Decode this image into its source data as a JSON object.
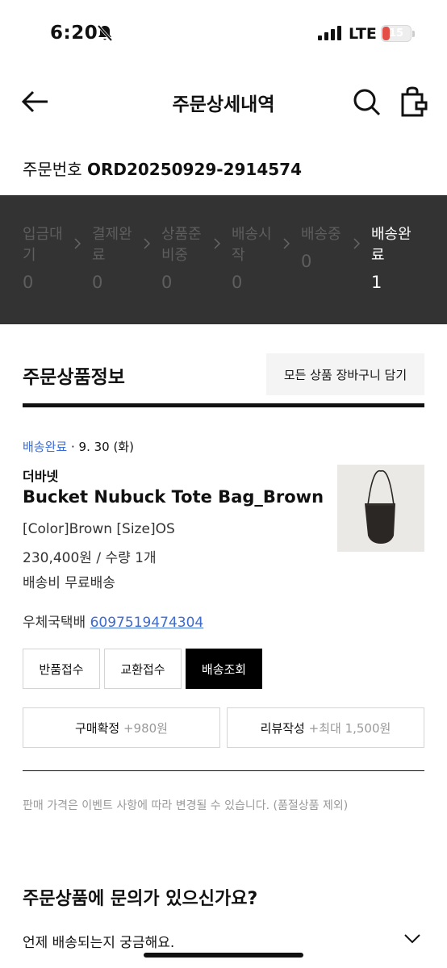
{
  "status_bar": {
    "time": "6:20",
    "network": "LTE",
    "battery": "15"
  },
  "header": {
    "title": "주문상세내역"
  },
  "order": {
    "label": "주문번호",
    "number": "ORD20250929-2914574"
  },
  "progress": {
    "steps": [
      {
        "label": "입금대기",
        "count": "0"
      },
      {
        "label": "결제완료",
        "count": "0"
      },
      {
        "label": "상품준비중",
        "count": "0"
      },
      {
        "label": "배송시작",
        "count": "0"
      },
      {
        "label": "배송중",
        "count": "0"
      },
      {
        "label": "배송완료",
        "count": "1"
      }
    ],
    "active_index": 5
  },
  "section": {
    "title": "주문상품정보",
    "cart_all_button": "모든 상품 장바구니 담기"
  },
  "product": {
    "status": "배송완료",
    "status_date": "· 9. 30 (화)",
    "brand": "더바넷",
    "name": "Bucket Nubuck Tote Bag_Brown",
    "options": "[Color]Brown [Size]OS",
    "price_qty": "230,400원 / 수량 1개",
    "shipping_fee": "배송비 무료배송",
    "courier": "우체국택배",
    "tracking_number": "6097519474304"
  },
  "actions": {
    "return": "반품접수",
    "exchange": "교환접수",
    "track": "배송조회",
    "confirm": "구매확정",
    "confirm_bonus": "+980원",
    "review": "리뷰작성",
    "review_bonus": "+최대 1,500원"
  },
  "notice": "판매 가격은 이벤트 사항에 따라 변경될 수 있습니다. (품절상품 제외)",
  "inquiry": {
    "title": "주문상품에 문의가 있으신가요?",
    "faq": "언제 배송되는지 궁금해요."
  },
  "colors": {
    "accent_blue": "#3c6bd1",
    "band_dark": "#333333",
    "battery_red": "#e34e46"
  }
}
